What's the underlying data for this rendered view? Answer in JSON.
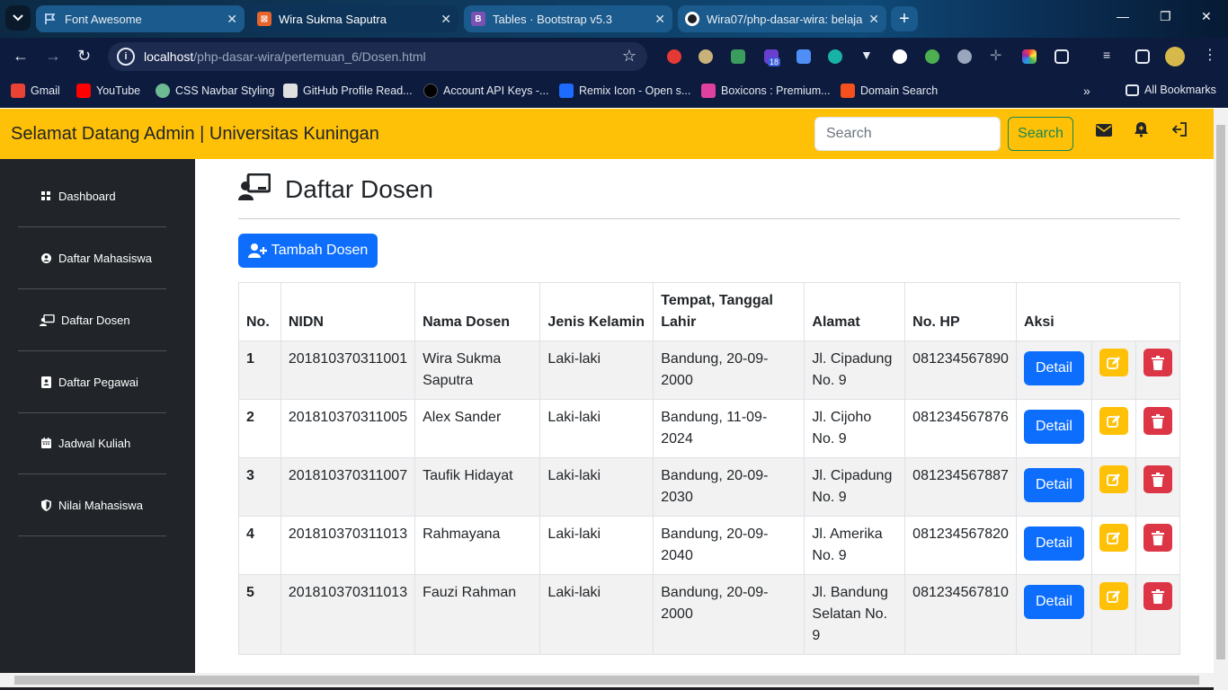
{
  "browser": {
    "tabs": [
      {
        "title": "Font Awesome",
        "icon": "flag-icon",
        "active": false
      },
      {
        "title": "Wira Sukma Saputra",
        "icon": "html-icon",
        "active": true
      },
      {
        "title": "Tables · Bootstrap v5.3",
        "icon": "bootstrap-icon",
        "active": false
      },
      {
        "title": "Wira07/php-dasar-wira: belajar",
        "icon": "github-icon",
        "active": false
      }
    ],
    "url_host": "localhost",
    "url_path": "/php-dasar-wira/pertemuan_6/Dosen.html",
    "bookmarks": [
      "Gmail",
      "YouTube",
      "CSS Navbar Styling",
      "GitHub Profile Read...",
      "Account API Keys -...",
      "Remix Icon - Open s...",
      "Boxicons : Premium...",
      "Domain Search"
    ],
    "all_bookmarks": "All Bookmarks",
    "extension_badge": "18"
  },
  "navbar": {
    "brand": "Selamat Datang Admin | Universitas Kuningan",
    "search_placeholder": "Search",
    "search_button": "Search"
  },
  "sidebar": {
    "items": [
      {
        "label": "Dashboard",
        "icon": "grid-icon"
      },
      {
        "label": "Daftar Mahasiswa",
        "icon": "user-circle-icon"
      },
      {
        "label": "Daftar Dosen",
        "icon": "chalkboard-teacher-icon"
      },
      {
        "label": "Daftar Pegawai",
        "icon": "id-badge-icon"
      },
      {
        "label": "Jadwal Kuliah",
        "icon": "calendar-icon"
      },
      {
        "label": "Nilai Mahasiswa",
        "icon": "shield-icon"
      }
    ]
  },
  "main": {
    "title": "Daftar Dosen",
    "add_button": "Tambah Dosen",
    "table": {
      "headers": [
        "No.",
        "NIDN",
        "Nama Dosen",
        "Jenis Kelamin",
        "Tempat, Tanggal Lahir",
        "Alamat",
        "No. HP",
        "Aksi"
      ],
      "detail_label": "Detail",
      "rows": [
        {
          "no": "1",
          "nidn": "201810370311001",
          "nama": "Wira Sukma Saputra",
          "jk": "Laki-laki",
          "ttl": "Bandung, 20-09-2000",
          "alamat": "Jl. Cipadung No. 9",
          "hp": "081234567890"
        },
        {
          "no": "2",
          "nidn": "201810370311005",
          "nama": "Alex Sander",
          "jk": "Laki-laki",
          "ttl": "Bandung, 11-09-2024",
          "alamat": "Jl. Cijoho No. 9",
          "hp": "081234567876"
        },
        {
          "no": "3",
          "nidn": "201810370311007",
          "nama": "Taufik Hidayat",
          "jk": "Laki-laki",
          "ttl": "Bandung, 20-09-2030",
          "alamat": "Jl. Cipadung No. 9",
          "hp": "081234567887"
        },
        {
          "no": "4",
          "nidn": "201810370311013",
          "nama": "Rahmayana",
          "jk": "Laki-laki",
          "ttl": "Bandung, 20-09-2040",
          "alamat": "Jl. Amerika No. 9",
          "hp": "081234567820"
        },
        {
          "no": "5",
          "nidn": "201810370311013",
          "nama": "Fauzi Rahman",
          "jk": "Laki-laki",
          "ttl": "Bandung, 20-09-2000",
          "alamat": "Jl. Bandung Selatan No. 9",
          "hp": "081234567810"
        }
      ]
    }
  },
  "colors": {
    "navbar": "#ffc107",
    "sidebar": "#212529",
    "primary": "#0d6efd",
    "warning": "#ffc107",
    "danger": "#dc3545",
    "success": "#198754"
  }
}
